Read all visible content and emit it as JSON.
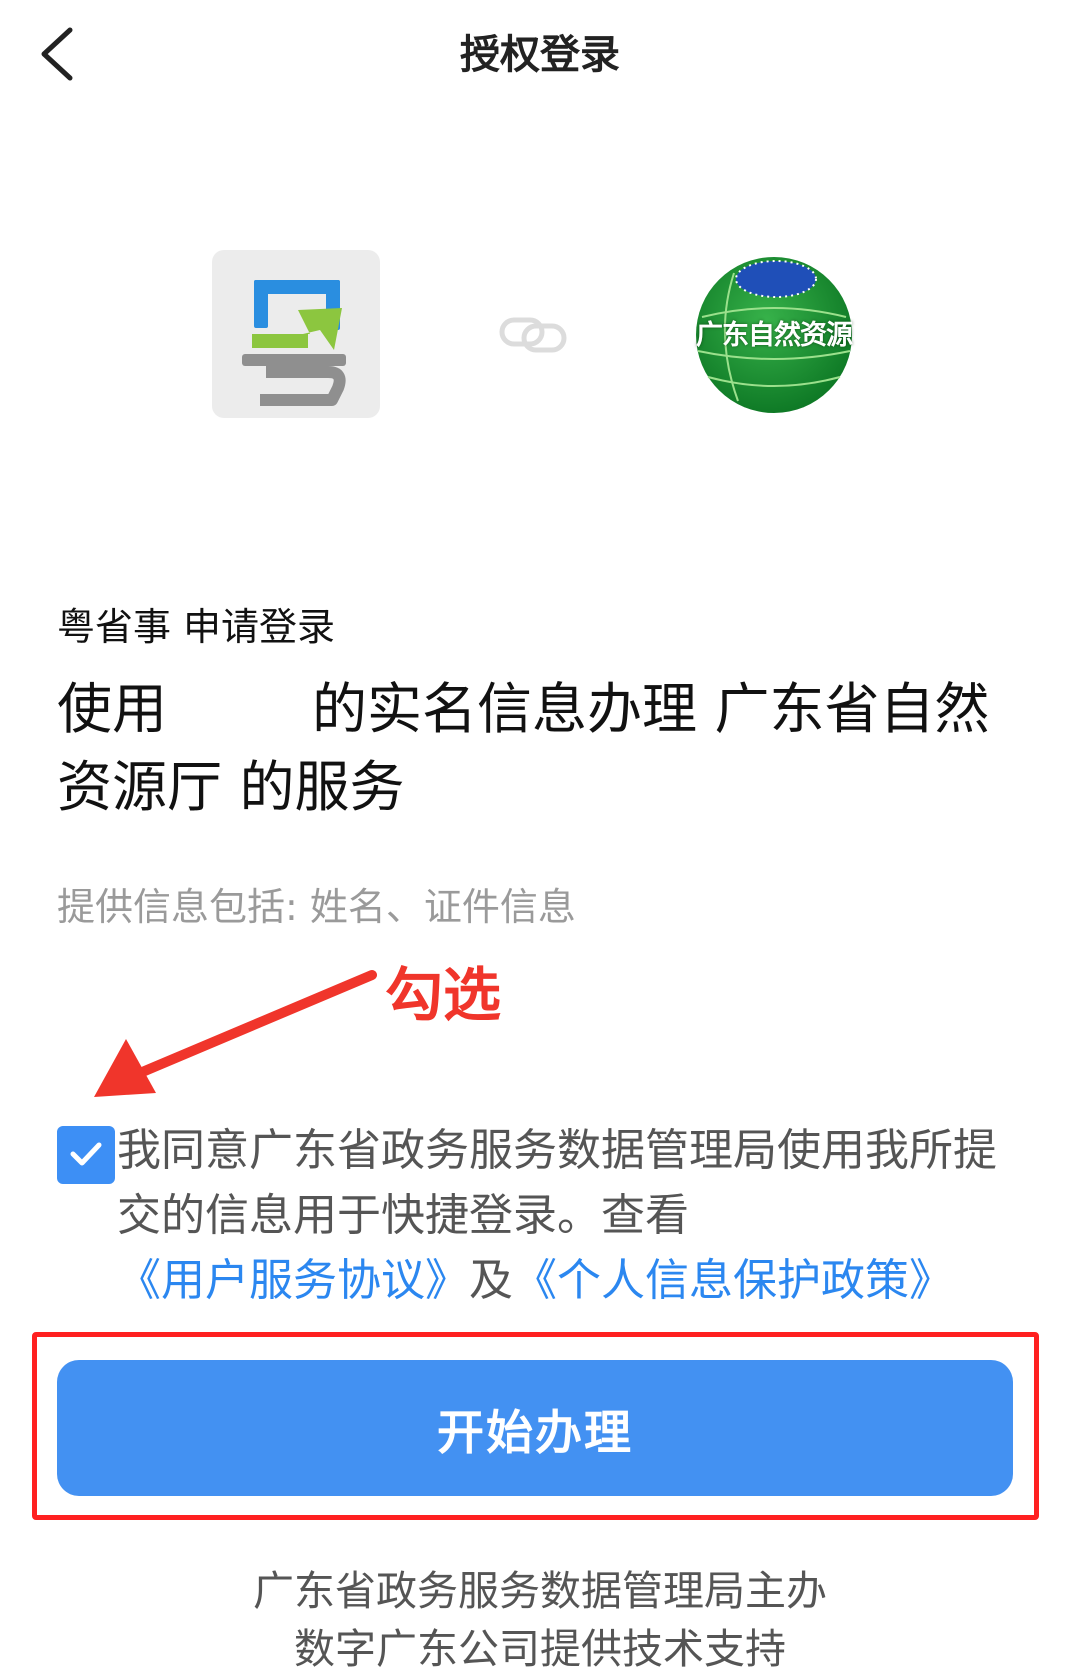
{
  "header": {
    "title": "授权登录",
    "back_icon": "chevron-left-icon"
  },
  "logos": {
    "app_logo_icon": "yueshengshi-logo",
    "link_icon": "link-icon",
    "dept_logo_text": "广东自然资源"
  },
  "request": {
    "app_name": "粤省事",
    "action": "申请登录"
  },
  "headline": {
    "part1": "使用",
    "part2": "的实名信息办理 广东省自然资源厅 的服务"
  },
  "info": "提供信息包括: 姓名、证件信息",
  "annotation": {
    "label": "勾选",
    "color": "#f0352b"
  },
  "agreement": {
    "checked": true,
    "text": "我同意广东省政务服务数据管理局使用我所提交的信息用于快捷登录。查看",
    "link1": "《用户服务协议》",
    "and": "及",
    "link2": "《个人信息保护政策》"
  },
  "button": {
    "label": "开始办理",
    "color": "#4391f2"
  },
  "footer": {
    "line1": "广东省政务服务数据管理局主办",
    "line2": "数字广东公司提供技术支持"
  }
}
